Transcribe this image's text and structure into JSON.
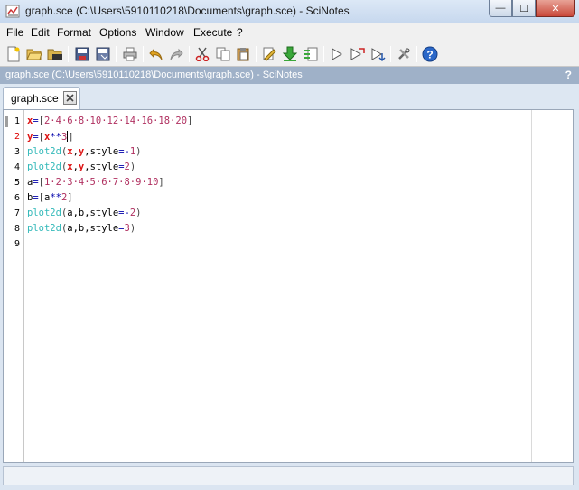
{
  "window": {
    "title": "graph.sce (C:\\Users\\5910110218\\Documents\\graph.sce) - SciNotes",
    "minimize": "—",
    "maximize": "☐",
    "close": "✕"
  },
  "menubar": [
    "File",
    "Edit",
    "Format",
    "Options",
    "Window",
    "Execute",
    "?"
  ],
  "toolbar_icons": [
    "new-file-icon",
    "open-folder-icon",
    "open-file-browser-icon",
    "save-icon",
    "save-as-icon",
    "print-icon",
    "undo-icon",
    "redo-icon",
    "cut-icon",
    "copy-icon",
    "paste-icon",
    "find-replace-icon",
    "load-into-scilab-icon",
    "load-file-icon",
    "execute-icon",
    "execute-echo-icon",
    "execute-until-icon",
    "preferences-icon",
    "help-icon"
  ],
  "doc_bar": {
    "title": "graph.sce (C:\\Users\\5910110218\\Documents\\graph.sce) - SciNotes",
    "help": "?"
  },
  "tab": {
    "label": "graph.sce"
  },
  "editor": {
    "current_line": 2,
    "line_numbers": [
      "1",
      "2",
      "3",
      "4",
      "5",
      "6",
      "7",
      "8",
      "9"
    ],
    "lines": [
      [
        {
          "t": "x",
          "c": "var"
        },
        {
          "t": "=",
          "c": "op"
        },
        {
          "t": "[",
          "c": "br"
        },
        {
          "t": "2·4·6·8·10·12·14·16·18·20",
          "c": "num"
        },
        {
          "t": "]",
          "c": "br"
        }
      ],
      [
        {
          "t": "y",
          "c": "var"
        },
        {
          "t": "=",
          "c": "op"
        },
        {
          "t": "[",
          "c": "br"
        },
        {
          "t": "x",
          "c": "var"
        },
        {
          "t": "**",
          "c": "op"
        },
        {
          "t": "3",
          "c": "num"
        },
        {
          "t": "]",
          "c": "br"
        }
      ],
      [
        {
          "t": "plot2d",
          "c": "fn"
        },
        {
          "t": "(",
          "c": "br"
        },
        {
          "t": "x",
          "c": "var"
        },
        {
          "t": ",",
          "c": "plain"
        },
        {
          "t": "y",
          "c": "var"
        },
        {
          "t": ",",
          "c": "plain"
        },
        {
          "t": "style",
          "c": "plain"
        },
        {
          "t": "=-",
          "c": "op"
        },
        {
          "t": "1",
          "c": "num"
        },
        {
          "t": ")",
          "c": "br"
        }
      ],
      [
        {
          "t": "plot2d",
          "c": "fn"
        },
        {
          "t": "(",
          "c": "br"
        },
        {
          "t": "x",
          "c": "var"
        },
        {
          "t": ",",
          "c": "plain"
        },
        {
          "t": "y",
          "c": "var"
        },
        {
          "t": ",",
          "c": "plain"
        },
        {
          "t": "style",
          "c": "plain"
        },
        {
          "t": "=",
          "c": "op"
        },
        {
          "t": "2",
          "c": "num"
        },
        {
          "t": ")",
          "c": "br"
        }
      ],
      [
        {
          "t": "a",
          "c": "plain"
        },
        {
          "t": "=",
          "c": "op"
        },
        {
          "t": "[",
          "c": "br"
        },
        {
          "t": "1·2·3·4·5·6·7·8·9·10",
          "c": "num"
        },
        {
          "t": "]",
          "c": "br"
        }
      ],
      [
        {
          "t": "b",
          "c": "plain"
        },
        {
          "t": "=",
          "c": "op"
        },
        {
          "t": "[",
          "c": "br"
        },
        {
          "t": "a",
          "c": "plain"
        },
        {
          "t": "**",
          "c": "op"
        },
        {
          "t": "2",
          "c": "num"
        },
        {
          "t": "]",
          "c": "br"
        }
      ],
      [
        {
          "t": "plot2d",
          "c": "fn"
        },
        {
          "t": "(",
          "c": "br"
        },
        {
          "t": "a,b,style",
          "c": "plain"
        },
        {
          "t": "=-",
          "c": "op"
        },
        {
          "t": "2",
          "c": "num"
        },
        {
          "t": ")",
          "c": "br"
        }
      ],
      [
        {
          "t": "plot2d",
          "c": "fn"
        },
        {
          "t": "(",
          "c": "br"
        },
        {
          "t": "a,b,style",
          "c": "plain"
        },
        {
          "t": "=",
          "c": "op"
        },
        {
          "t": "3",
          "c": "num"
        },
        {
          "t": ")",
          "c": "br"
        }
      ],
      []
    ]
  }
}
